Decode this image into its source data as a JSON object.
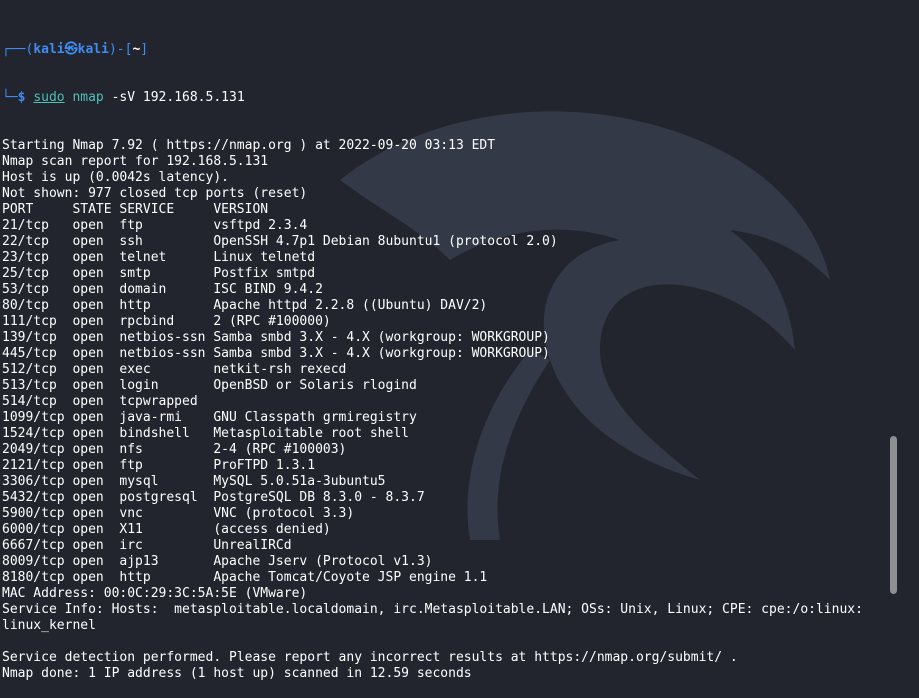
{
  "prompt": {
    "line1_prefix": "┌──(",
    "user": "kali",
    "at_symbol": "㉿",
    "host": "kali",
    "dir_open": ")-[",
    "dir": "~",
    "dir_close": "]",
    "line2_prefix": "└─",
    "dollar": "$ ",
    "sudo": "sudo",
    "cmd": "nmap",
    "args": " -sV 192.168.5.131"
  },
  "output": [
    "Starting Nmap 7.92 ( https://nmap.org ) at 2022-09-20 03:13 EDT",
    "Nmap scan report for 192.168.5.131",
    "Host is up (0.0042s latency).",
    "Not shown: 977 closed tcp ports (reset)",
    "PORT     STATE SERVICE     VERSION",
    "21/tcp   open  ftp         vsftpd 2.3.4",
    "22/tcp   open  ssh         OpenSSH 4.7p1 Debian 8ubuntu1 (protocol 2.0)",
    "23/tcp   open  telnet      Linux telnetd",
    "25/tcp   open  smtp        Postfix smtpd",
    "53/tcp   open  domain      ISC BIND 9.4.2",
    "80/tcp   open  http        Apache httpd 2.2.8 ((Ubuntu) DAV/2)",
    "111/tcp  open  rpcbind     2 (RPC #100000)",
    "139/tcp  open  netbios-ssn Samba smbd 3.X - 4.X (workgroup: WORKGROUP)",
    "445/tcp  open  netbios-ssn Samba smbd 3.X - 4.X (workgroup: WORKGROUP)",
    "512/tcp  open  exec        netkit-rsh rexecd",
    "513/tcp  open  login       OpenBSD or Solaris rlogind",
    "514/tcp  open  tcpwrapped",
    "1099/tcp open  java-rmi    GNU Classpath grmiregistry",
    "1524/tcp open  bindshell   Metasploitable root shell",
    "2049/tcp open  nfs         2-4 (RPC #100003)",
    "2121/tcp open  ftp         ProFTPD 1.3.1",
    "3306/tcp open  mysql       MySQL 5.0.51a-3ubuntu5",
    "5432/tcp open  postgresql  PostgreSQL DB 8.3.0 - 8.3.7",
    "5900/tcp open  vnc         VNC (protocol 3.3)",
    "6000/tcp open  X11         (access denied)",
    "6667/tcp open  irc         UnrealIRCd",
    "8009/tcp open  ajp13       Apache Jserv (Protocol v1.3)",
    "8180/tcp open  http        Apache Tomcat/Coyote JSP engine 1.1",
    "MAC Address: 00:0C:29:3C:5A:5E (VMware)",
    "Service Info: Hosts:  metasploitable.localdomain, irc.Metasploitable.LAN; OSs: Unix, Linux; CPE: cpe:/o:linux:",
    "linux_kernel",
    "",
    "Service detection performed. Please report any incorrect results at https://nmap.org/submit/ .",
    "Nmap done: 1 IP address (1 host up) scanned in 12.59 seconds"
  ],
  "colors": {
    "background": "#22252e",
    "prompt_blue": "#3f8cf2",
    "command_teal": "#4ec0b6",
    "text": "#ffffff",
    "scroll_thumb": "#8e8f93"
  },
  "icons": {
    "background_logo": "kali-dragon-logo"
  }
}
